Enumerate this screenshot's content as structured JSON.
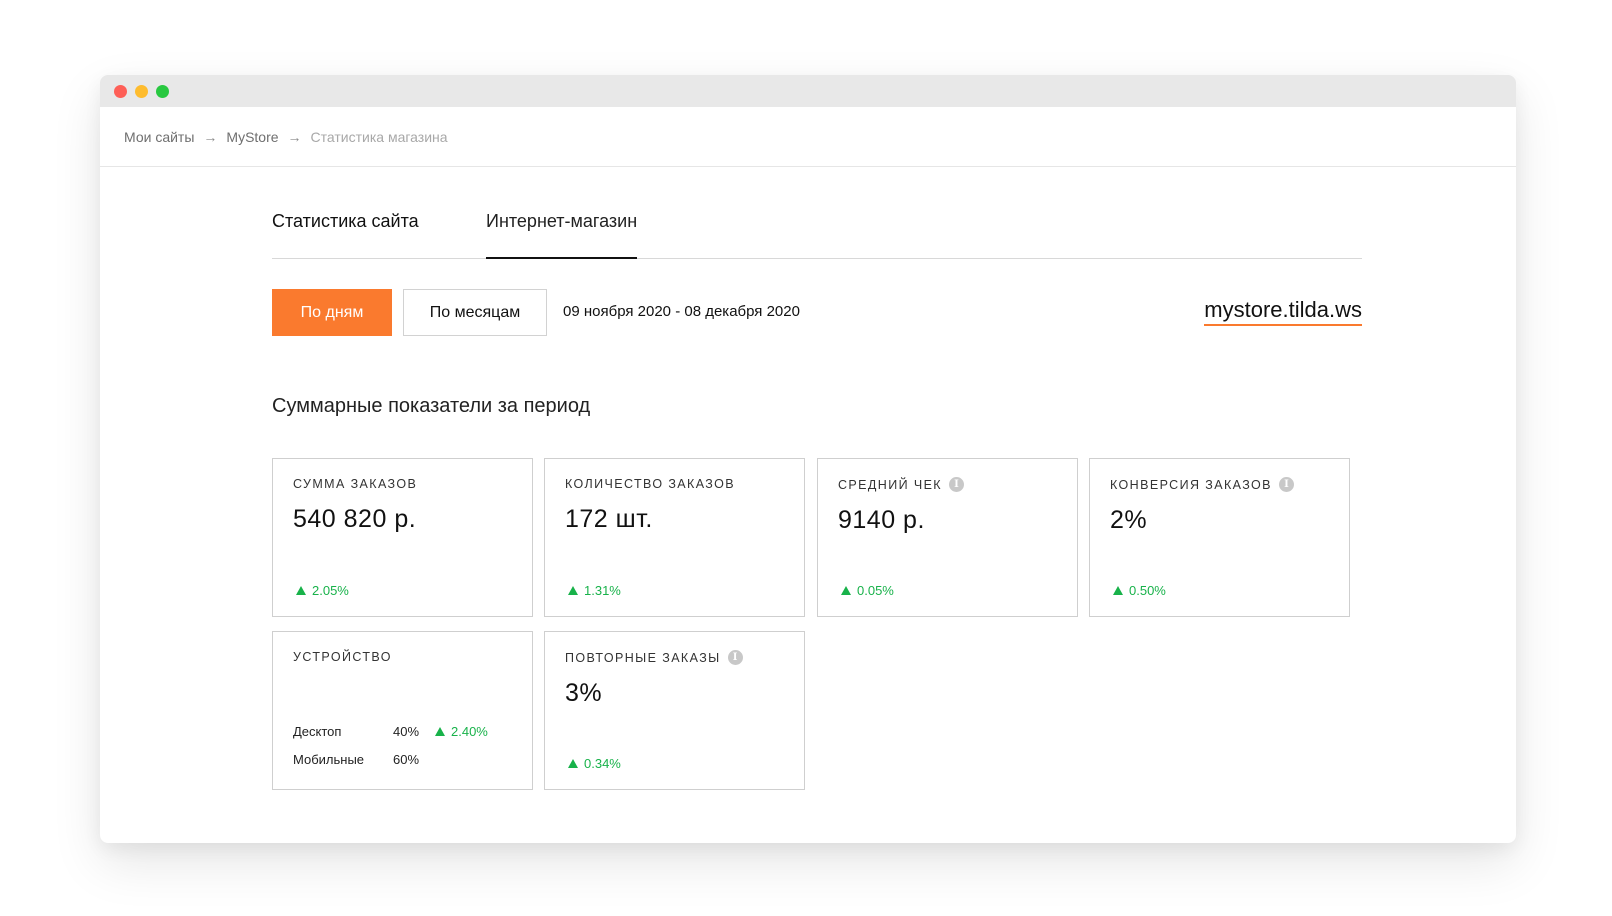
{
  "breadcrumb": {
    "items": [
      "Мои сайты",
      "MyStore",
      "Статистика магазина"
    ],
    "separator": "→"
  },
  "tabs": [
    {
      "label": "Статистика сайта",
      "active": false
    },
    {
      "label": "Интернет-магазин",
      "active": true
    }
  ],
  "controls": {
    "by_days": "По дням",
    "by_months": "По месяцам",
    "date_range": "09 ноября 2020 - 08 декабря 2020",
    "domain": "mystore.tilda.ws"
  },
  "section_title": "Суммарные показатели за период",
  "cards": {
    "orders_sum": {
      "label": "Сумма заказов",
      "value": "540 820 р.",
      "change": "2.05%"
    },
    "orders_count": {
      "label": "Количество заказов",
      "value": "172 шт.",
      "change": "1.31%"
    },
    "avg_check": {
      "label": "Средний чек",
      "value": "9140 р.",
      "change": "0.05%",
      "info": "i"
    },
    "conversion": {
      "label": "Конверсия заказов",
      "value": "2%",
      "change": "0.50%",
      "info": "i"
    },
    "device": {
      "label": "Устройство",
      "rows": [
        {
          "name": "Десктоп",
          "pct": "40%",
          "change": "2.40%"
        },
        {
          "name": "Мобильные",
          "pct": "60%",
          "change": ""
        }
      ]
    },
    "repeat_orders": {
      "label": "Повторные заказы",
      "value": "3%",
      "change": "0.34%",
      "info": "i"
    }
  },
  "colors": {
    "accent": "#fa7a2e",
    "positive": "#18b24a"
  }
}
